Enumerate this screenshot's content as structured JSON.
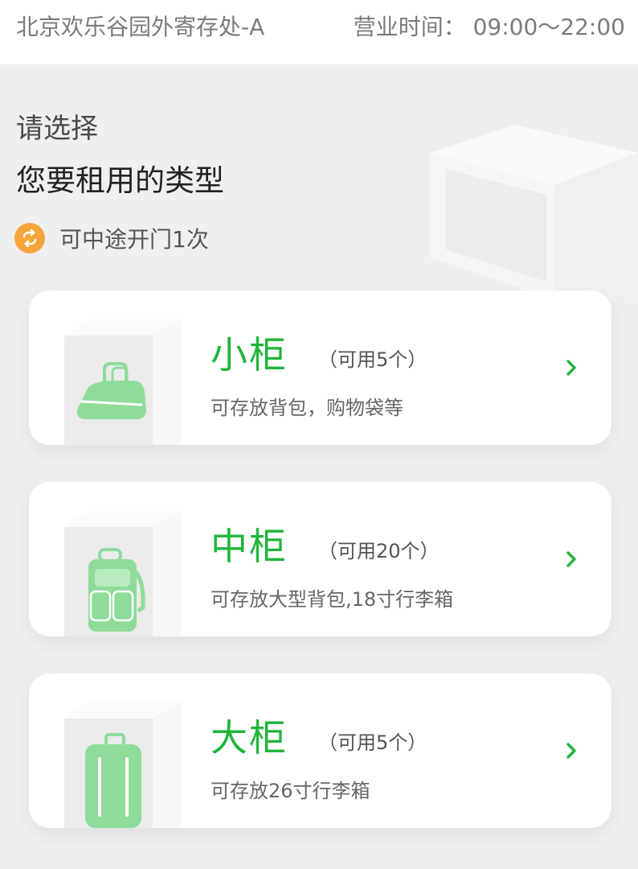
{
  "header": {
    "location": "北京欢乐谷园外寄存处-A",
    "hours": "营业时间： 09:00～22:00"
  },
  "prompt": {
    "line1": "请选择",
    "line2": "您要租用的类型",
    "reopen_text": "可中途开门1次",
    "reopen_icon": "repeat-icon"
  },
  "colors": {
    "accent_green": "#20b53a",
    "badge_orange": "#f5a53b",
    "background": "#efeff0"
  },
  "lockers": [
    {
      "name": "小柜",
      "availability": "（可用5个）",
      "description": "可存放背包，购物袋等",
      "icon": "shopping-bag-icon"
    },
    {
      "name": "中柜",
      "availability": "（可用20个）",
      "description": "可存放大型背包,18寸行李箱",
      "icon": "backpack-icon"
    },
    {
      "name": "大柜",
      "availability": "（可用5个）",
      "description": "可存放26寸行李箱",
      "icon": "suitcase-icon"
    }
  ]
}
